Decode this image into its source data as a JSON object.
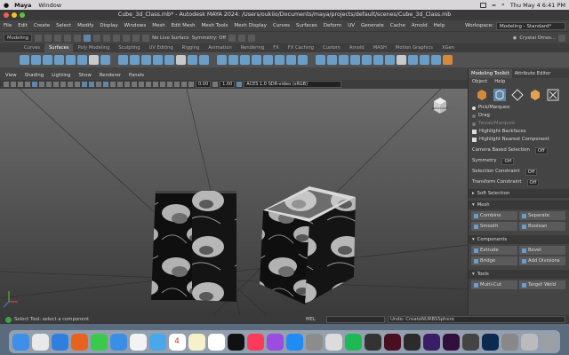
{
  "mac_menubar": {
    "app": "Maya",
    "items": [
      "Window"
    ],
    "clock": "Thu May 4  6:41 PM"
  },
  "window": {
    "title": "Cube_3d_Class.mb* - Autodesk MAYA 2024: /Users/oukiio/Documents/maya/projects/default/scenes/Cube_3d_Class.mb"
  },
  "main_menu": {
    "items": [
      "File",
      "Edit",
      "Create",
      "Select",
      "Modify",
      "Display",
      "Windows",
      "Mesh",
      "Edit Mesh",
      "Mesh Tools",
      "Mesh Display",
      "Curves",
      "Surfaces",
      "Deform",
      "UV",
      "Generate",
      "Cache",
      "Arnold",
      "Help"
    ],
    "workspace_label": "Workspace:",
    "workspace_value": "Modeling - Standard*"
  },
  "status_line": {
    "mode": "Modeling",
    "live_surface": "No Live Surface",
    "symmetry": "Symmetry: Off",
    "user": "Crystal Omos..."
  },
  "shelf_tabs": {
    "items": [
      "Curves",
      "Surfaces",
      "Poly Modeling",
      "Sculpting",
      "UV Editing",
      "Rigging",
      "Animation",
      "Rendering",
      "FX",
      "FX Caching",
      "Custom",
      "Arnold",
      "MASH",
      "Motion Graphics",
      "XGen"
    ],
    "active": "Surfaces"
  },
  "panel_menu": {
    "items": [
      "View",
      "Shading",
      "Lighting",
      "Show",
      "Renderer",
      "Panels"
    ]
  },
  "panel_toolbar": {
    "field_a": "0.00",
    "field_b": "1.00",
    "color_space": "ACES 1.0 SDR-video (sRGB)"
  },
  "viewport": {
    "view_cube_label": "PERSP-FRONT"
  },
  "modeling_toolkit": {
    "tabs": [
      "Modeling Toolkit",
      "Attribute Editor"
    ],
    "menu": [
      "Object",
      "Help"
    ],
    "pick_marquee": "Pick/Marquee",
    "drag": "Drag",
    "tweak_marquee": "Tweak/Marquee",
    "highlight_backfaces": "Highlight Backfaces",
    "highlight_nearest": "Highlight Nearest Component",
    "camera_based": "Camera Based Selection",
    "camera_based_value": "Off",
    "symmetry": "Symmetry",
    "symmetry_value": "Off",
    "selection_constraint": "Selection Constraint",
    "selection_constraint_value": "Off",
    "transform_constraint": "Transform Constraint",
    "transform_constraint_value": "Off",
    "soft_selection": "Soft Selection",
    "mesh_section": "Mesh",
    "combine": "Combine",
    "separate": "Separate",
    "smooth": "Smooth",
    "boolean": "Boolean",
    "components_section": "Components",
    "extrude": "Extrude",
    "bevel": "Bevel",
    "bridge": "Bridge",
    "add_divisions": "Add Divisions",
    "tools_section": "Tools",
    "multi_cut": "Multi-Cut",
    "target_weld": "Target Weld"
  },
  "bottom": {
    "help": "Select Tool: select a component",
    "mel": "MEL",
    "result": "Undo: CreateNURBSSphere"
  },
  "dock": {
    "calendar_day": "4"
  },
  "colors": {
    "accent": "#5f86a8",
    "viewport_top": "#6d6d6d",
    "viewport_bottom": "#3a3a3a"
  }
}
